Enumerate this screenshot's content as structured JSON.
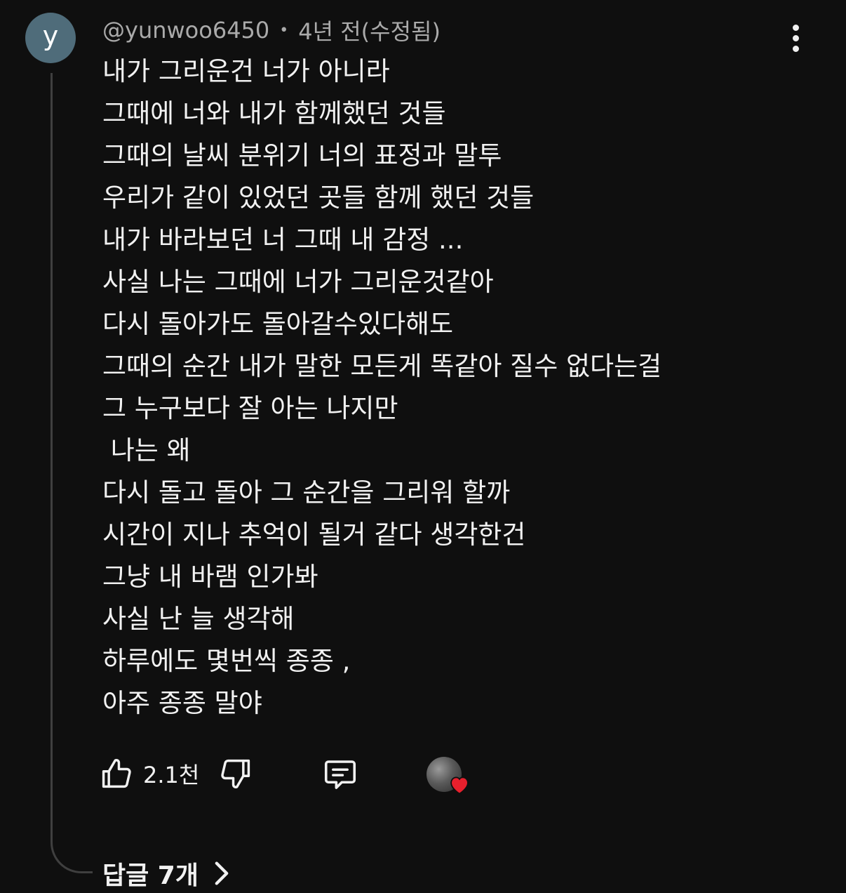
{
  "comment": {
    "avatar_letter": "y",
    "author": "@yunwoo6450",
    "separator": "•",
    "time": "4년 전(수정됨)",
    "lines": [
      "내가 그리운건 너가 아니라",
      "그때에 너와 내가 함께했던 것들",
      "그때의 날씨 분위기 너의 표정과 말투",
      "우리가 같이 있었던 곳들 함께 했던 것들",
      "내가 바라보던 너 그때 내 감정 ...",
      "사실 나는 그때에 너가 그리운것같아",
      "다시 돌아가도 돌아갈수있다해도",
      "그때의 순간 내가 말한 모든게 똑같아 질수 없다는걸",
      "그 누구보다 잘 아는 나지만",
      " 나는 왜",
      "다시 돌고 돌아 그 순간을 그리워 할까",
      "시간이 지나 추억이 될거 같다 생각한건",
      "그냥 내 바램 인가봐",
      "사실 난 늘 생각해",
      "하루에도 몇번씩 종종 ,",
      "아주 종종 말야"
    ]
  },
  "actions": {
    "like_count": "2.1천",
    "like_icon": "thumbs-up-icon",
    "dislike_icon": "thumbs-down-icon",
    "reply_icon": "comment-icon",
    "heart_icon": "creator-heart-icon",
    "heart_color": "#e8202d"
  },
  "replies": {
    "label": "답글 7개"
  },
  "colors": {
    "background": "#0f0f0f",
    "text": "#f1f1f1",
    "meta": "#aaaaaa",
    "avatar": "#4f6c7a"
  }
}
